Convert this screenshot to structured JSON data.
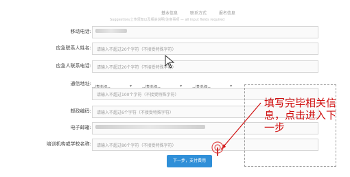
{
  "top": {
    "tabs": [
      "基本信息",
      "联系方式",
      "报名信息"
    ],
    "note": "Suggestion/上传须知以及相关说明/注意事项 — all input fields required"
  },
  "form": {
    "rows": [
      {
        "label": "移动电话:",
        "type": "blurred",
        "value": ""
      },
      {
        "label": "应急联系人姓名:",
        "type": "input",
        "placeholder": "请输入不超过20个字符（不接受特殊字符）"
      },
      {
        "label": "应急人联系电话:",
        "type": "input",
        "placeholder": "请输入不超过20个字符（不接受特殊字符）"
      },
      {
        "label": "通信地址:",
        "type": "address",
        "selects": [
          "--请选择--",
          "--请选择--",
          "--请选择--"
        ],
        "placeholder": "请输入不超过100个字符（不接受特殊字符）"
      },
      {
        "label": "邮政编码:",
        "type": "input",
        "placeholder": "请输入不超过6个字符（不接受特殊字符）"
      },
      {
        "label": "电子邮箱:",
        "type": "blurred",
        "value": ""
      },
      {
        "label": "培训机构或学校名称:",
        "type": "input",
        "placeholder": "请输入不超过80个字符（不接受特殊字符）"
      }
    ]
  },
  "next_button": "下一步，支付费用",
  "annotation": {
    "text": "填写完毕相关信息，点击进入下一步",
    "color": "#d01010"
  }
}
